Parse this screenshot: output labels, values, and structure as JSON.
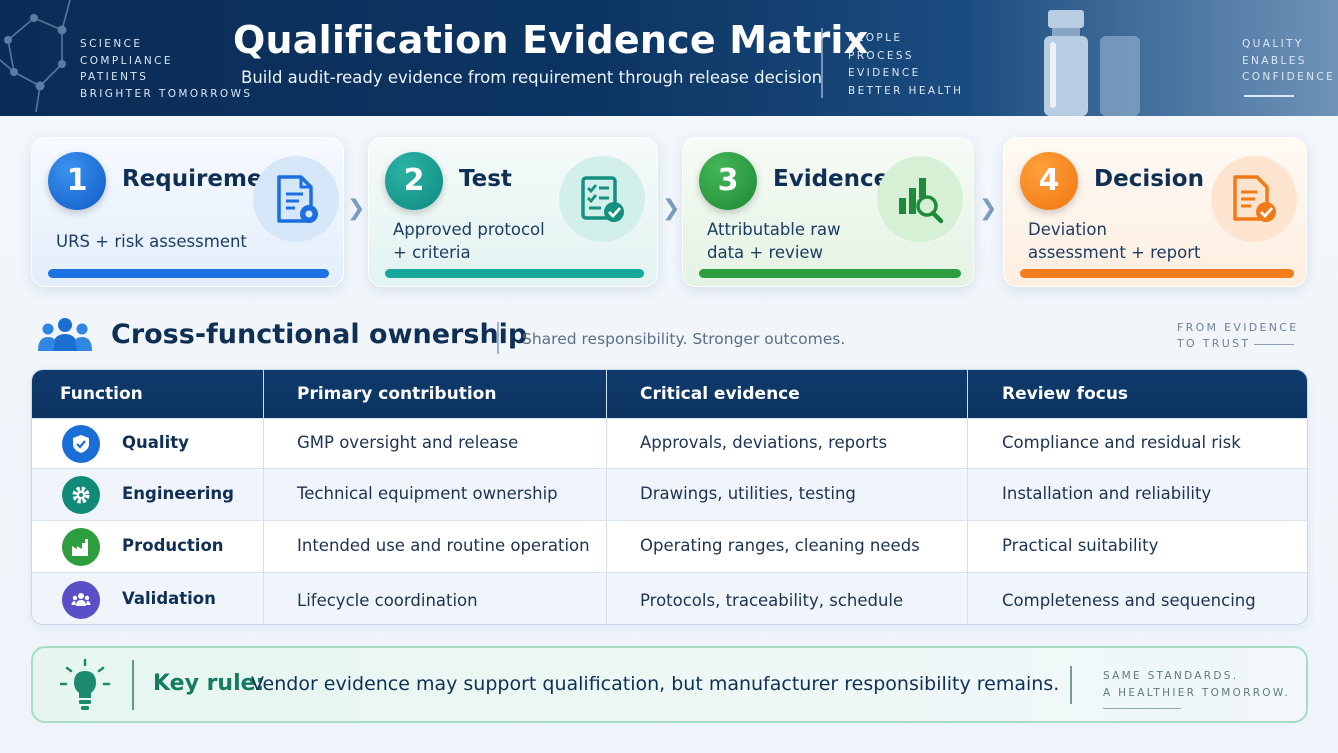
{
  "header": {
    "title": "Qualification Evidence Matrix",
    "subtitle": "Build audit-ready evidence from requirement through release decision",
    "tagline_left": [
      "SCIENCE",
      "COMPLIANCE",
      "PATIENTS",
      "BRIGHTER TOMORROWS"
    ],
    "tagline_mid": [
      "PEOPLE",
      "PROCESS",
      "EVIDENCE",
      "BETTER HEALTH"
    ],
    "tagline_right": [
      "QUALITY",
      "ENABLES",
      "CONFIDENCE"
    ]
  },
  "steps": [
    {
      "number": "1",
      "title": "Requirement",
      "description": "URS + risk assessment",
      "icon": "document-gear-icon",
      "color": "#1b72e0"
    },
    {
      "number": "2",
      "title": "Test",
      "description": "Approved protocol + criteria",
      "icon": "checklist-icon",
      "color": "#16a89b"
    },
    {
      "number": "3",
      "title": "Evidence",
      "description": "Attributable raw data + review",
      "icon": "chart-magnifier-icon",
      "color": "#2e9d3f"
    },
    {
      "number": "4",
      "title": "Decision",
      "description": "Deviation assessment + report",
      "icon": "report-check-icon",
      "color": "#f47c1b"
    }
  ],
  "section": {
    "title": "Cross-functional ownership",
    "subtitle": "Shared responsibility. Stronger outcomes.",
    "tag": [
      "FROM EVIDENCE",
      "TO TRUST"
    ]
  },
  "table": {
    "headers": [
      "Function",
      "Primary contribution",
      "Critical evidence",
      "Review focus"
    ],
    "rows": [
      {
        "function": "Quality",
        "icon": "shield-check-icon",
        "icon_color": "#1a6fd6",
        "contribution": "GMP oversight and release",
        "evidence": "Approvals, deviations, reports",
        "focus": "Compliance and residual risk"
      },
      {
        "function": "Engineering",
        "icon": "gear-icon",
        "icon_color": "#128a78",
        "contribution": "Technical equipment ownership",
        "evidence": "Drawings, utilities, testing",
        "focus": "Installation and reliability"
      },
      {
        "function": "Production",
        "icon": "factory-icon",
        "icon_color": "#2e9d3f",
        "contribution": "Intended use and routine operation",
        "evidence": "Operating ranges, cleaning needs",
        "focus": "Practical suitability"
      },
      {
        "function": "Validation",
        "icon": "team-icon",
        "icon_color": "#5b4fc7",
        "contribution": "Lifecycle coordination",
        "evidence": "Protocols, traceability, schedule",
        "focus": "Completeness and sequencing"
      }
    ]
  },
  "key_rule": {
    "label": "Key rule:",
    "text": "Vendor evidence may support qualification, but manufacturer responsibility remains.",
    "tag": [
      "SAME STANDARDS.",
      "A HEALTHIER TOMORROW."
    ]
  }
}
